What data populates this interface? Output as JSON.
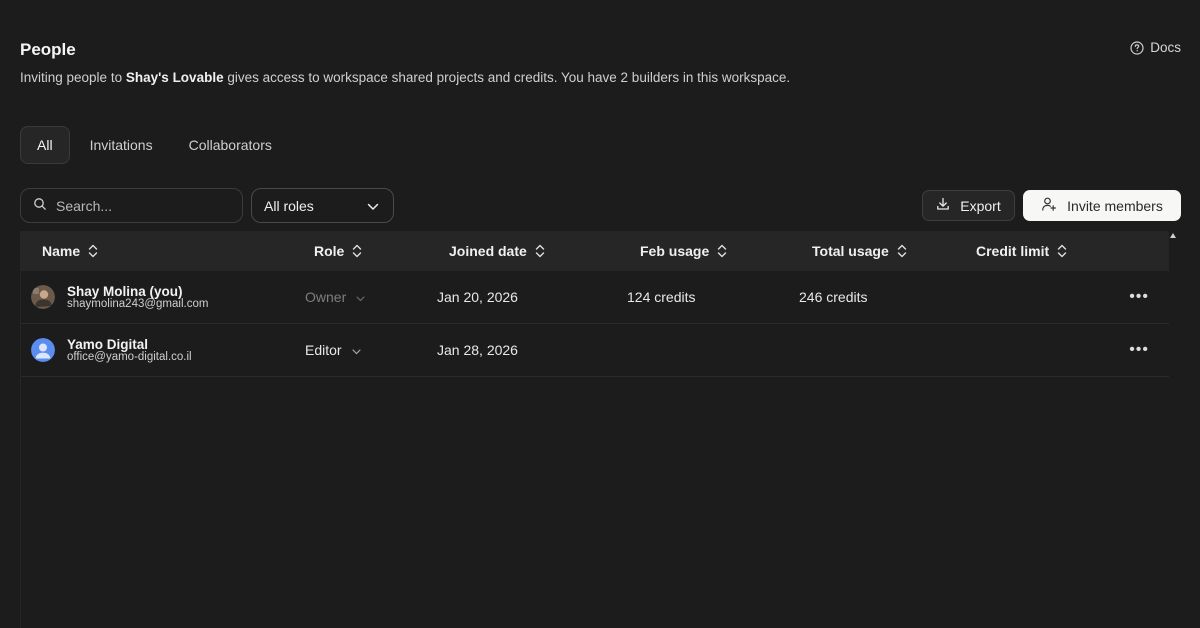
{
  "header": {
    "title": "People",
    "subtitle_prefix": "Inviting people to ",
    "workspace_name": "Shay's Lovable",
    "subtitle_suffix": " gives access to workspace shared projects and credits. You have 2 builders in this workspace.",
    "docs_label": "Docs"
  },
  "tabs": [
    {
      "label": "All",
      "active": true
    },
    {
      "label": "Invitations",
      "active": false
    },
    {
      "label": "Collaborators",
      "active": false
    }
  ],
  "toolbar": {
    "search_placeholder": "Search...",
    "role_filter": "All roles",
    "export_label": "Export",
    "invite_label": "Invite members"
  },
  "table": {
    "columns": [
      "Name",
      "Role",
      "Joined date",
      "Feb usage",
      "Total usage",
      "Credit limit"
    ],
    "rows": [
      {
        "name": "Shay Molina (you)",
        "email": "shaymolina243@gmail.com",
        "role": "Owner",
        "joined": "Jan 20, 2026",
        "feb_usage": "124 credits",
        "total_usage": "246 credits",
        "credit_limit": ""
      },
      {
        "name": "Yamo Digital",
        "email": "office@yamo-digital.co.il",
        "role": "Editor",
        "joined": "Jan 28, 2026",
        "feb_usage": "",
        "total_usage": "",
        "credit_limit": ""
      }
    ]
  },
  "icons": {
    "docs": "help-circle-icon",
    "search": "search-icon",
    "dropdown": "chevron-down-icon",
    "export": "download-icon",
    "invite": "user-plus-icon",
    "sort": "sort-icon",
    "more": "more-horizontal-icon"
  },
  "colors": {
    "background": "#1c1c1c",
    "header_row": "#262626",
    "primary_button": "#f7f7f5",
    "avatar_blue": "#5b8def"
  }
}
